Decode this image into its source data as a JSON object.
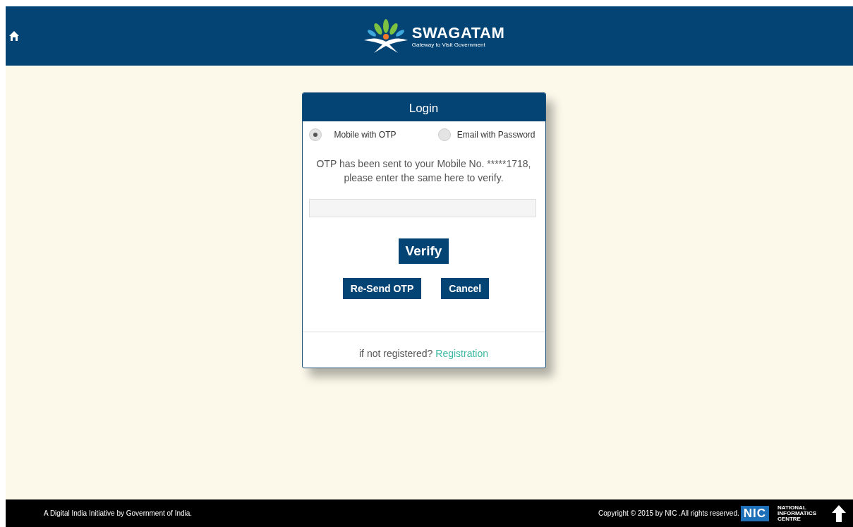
{
  "header": {
    "brand": "SWAGATAM",
    "tagline": "Gateway to Visit Government"
  },
  "login": {
    "title": "Login",
    "options": [
      {
        "label": "Mobile with OTP",
        "selected": true
      },
      {
        "label": "Email with Password",
        "selected": false
      }
    ],
    "message": "OTP has been sent to your Mobile No. *****1718, please enter the same here to verify.",
    "verify_button": "Verify",
    "buttons": [
      "Re-Send OTP",
      "Cancel"
    ],
    "register_prompt": "if not registered?",
    "register_link": "Registration"
  },
  "footer": {
    "left": "A Digital India Initiative by Government of India.",
    "copyright": "Copyright © 2015 by NIC .All rights reserved.",
    "nic_logo": "NIC",
    "nic_name": [
      "NATIONAL",
      "INFORMATICS",
      "CENTRE"
    ]
  }
}
